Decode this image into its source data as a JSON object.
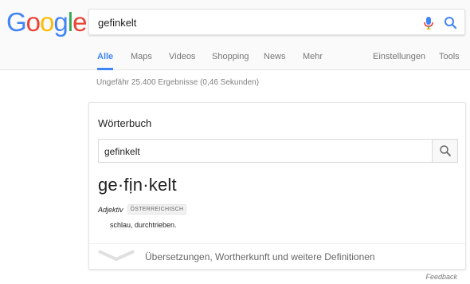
{
  "logo": {
    "letters": [
      "G",
      "o",
      "o",
      "g",
      "l",
      "e"
    ],
    "colors": [
      "#4285F4",
      "#EA4335",
      "#FBBC05",
      "#4285F4",
      "#34A853",
      "#EA4335"
    ]
  },
  "search": {
    "query": "gefinkelt",
    "mic_icon": "microphone-icon",
    "search_icon": "search-icon"
  },
  "tabs": [
    {
      "label": "Alle",
      "active": true
    },
    {
      "label": "Maps"
    },
    {
      "label": "Videos"
    },
    {
      "label": "Shopping"
    },
    {
      "label": "News"
    },
    {
      "label": "Mehr"
    },
    {
      "label": "Einstellungen"
    },
    {
      "label": "Tools"
    }
  ],
  "results_stats": "Ungefähr 25.400 Ergebnisse (0,46 Sekunden)",
  "dictionary": {
    "title": "Wörterbuch",
    "input_value": "gefinkelt",
    "headword": "ge·fịn·kelt",
    "part_of_speech": "Adjektiv",
    "region_badge": "ÖSTERREICHISCH",
    "definition": "schlau, durchtrieben.",
    "more_label": "Übersetzungen, Wortherkunft und weitere Definitionen"
  },
  "feedback_label": "Feedback",
  "colors": {
    "accent": "#4285f4",
    "tab_inactive": "#777777",
    "mic_blue": "#4285f4",
    "mic_red": "#ea4335"
  }
}
